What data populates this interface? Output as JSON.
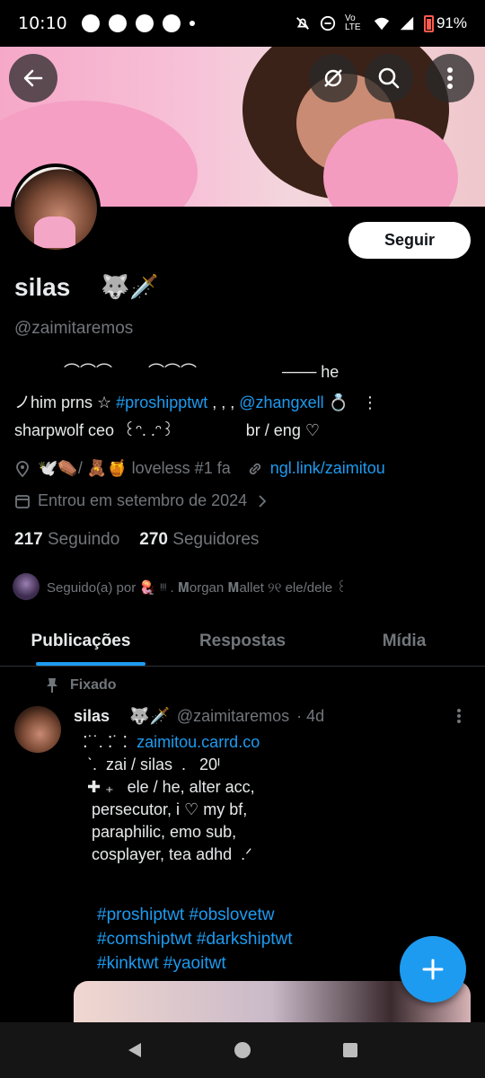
{
  "status_bar": {
    "time": "10:10",
    "battery": "91%",
    "network": "Vo LTE"
  },
  "header": {
    "back_icon": "arrow-left-icon",
    "translate_icon": "translate-icon",
    "search_icon": "search-icon",
    "more_icon": "more-vertical-icon"
  },
  "profile": {
    "follow_label": "Seguir",
    "name": "silas",
    "name_emoji": "🐺🗡️",
    "handle": "@zaimitaremos",
    "bio_line1": "           ⌒⌒⌒        ⌒⌒⌒                   ─── he",
    "bio_line2_a": "ノhim prns ☆ ",
    "bio_line2_tag": "#proshipptwt",
    "bio_line2_b": " , , , ",
    "bio_line2_mention": "@zhangxell",
    "bio_line2_c": " 💍   ⋮",
    "bio_line3": "sharpwolf ceo  ꒰ᵔ. .ᵔ꒱                br / eng ♡",
    "location": "🕊️⚰️/ 🧸🍯 loveless #1 fa",
    "website": "ngl.link/zaimitou",
    "joined": "Entrou em setembro de 2024",
    "following_count": "217",
    "following_label": "Seguindo",
    "followers_count": "270",
    "followers_label": "Seguidores",
    "followed_by": "Seguido(a) por 🪼 ᵎᵎᵎ  .  𝐌organ 𝐌allet ୨୧ ele/dele ꒰"
  },
  "tabs": [
    {
      "label": "Publicações",
      "active": true
    },
    {
      "label": "Respostas",
      "active": false
    },
    {
      "label": "Mídia",
      "active": false
    }
  ],
  "post": {
    "pinned_label": "Fixado",
    "author_name": "silas",
    "author_emoji": "🐺🗡️",
    "author_handle": "@zaimitaremos",
    "age": "· 4d",
    "line1_prefix": "  ⁚˙˙. ⁚˙ ⁚  ",
    "line1_link": "zaimitou.carrd.co",
    "body": "   ˋ.  zai / silas  .   20ᴵ\n   ✚ ₊   ele / he, alter acc,\n    persecutor, i ♡ my bf,\n    paraphilic, emo sub,\n    cosplayer, tea adhd  .ᐟ",
    "tags": "#proshiptwt #obslovetw\n#comshiptwt #darkshiptwt\n#kinktwt #yaoitwt"
  },
  "accent_color": "#1d9bf0"
}
